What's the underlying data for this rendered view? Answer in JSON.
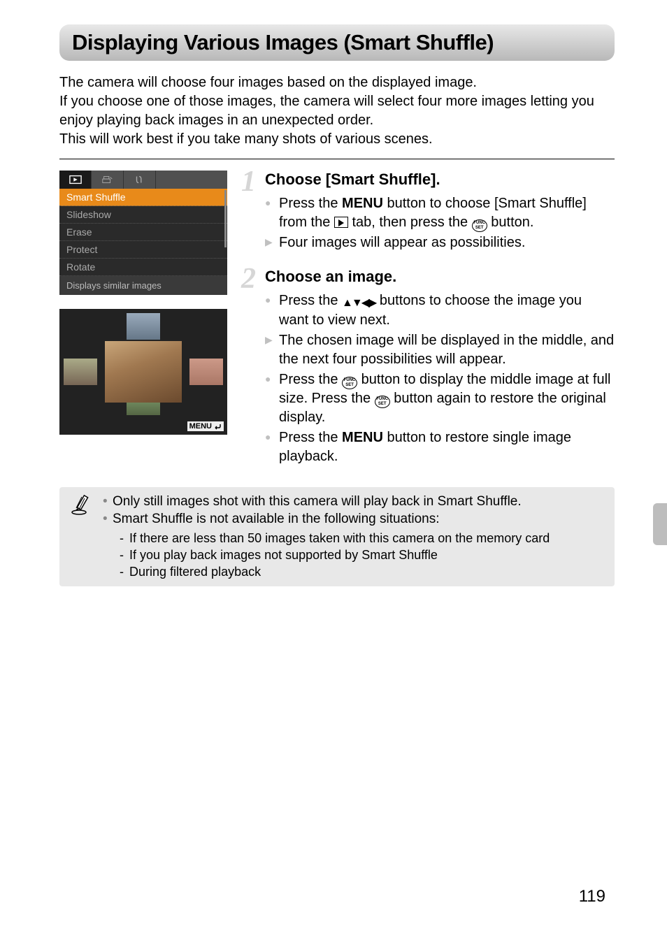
{
  "title": "Displaying Various Images (Smart Shuffle)",
  "intro": "The camera will choose four images based on the displayed image.\nIf you choose one of those images, the camera will select four more images letting you enjoy playing back images in an unexpected order.\nThis will work best if you take many shots of various scenes.",
  "camera_menu": {
    "items": [
      "Smart Shuffle",
      "Slideshow",
      "Erase",
      "Protect",
      "Rotate"
    ],
    "hint": "Displays similar images"
  },
  "preview": {
    "menu_label": "MENU"
  },
  "steps": [
    {
      "num": "1",
      "title": "Choose [Smart Shuffle].",
      "bullets": [
        {
          "kind": "circle",
          "pre": "Press the ",
          "menu": "MENU",
          "mid1": " button to choose [Smart Shuffle] from the ",
          "playtab": true,
          "mid2": " tab, then press the ",
          "func": true,
          "post": " button."
        },
        {
          "kind": "tri",
          "text": "Four images will appear as possibilities."
        }
      ]
    },
    {
      "num": "2",
      "title": "Choose an image.",
      "bullets": [
        {
          "kind": "circle",
          "pre": "Press the ",
          "arrows": true,
          "post": " buttons to choose the image you want to view next."
        },
        {
          "kind": "tri",
          "text": "The chosen image will be displayed in the middle, and the next four possibilities will appear."
        },
        {
          "kind": "circle",
          "pre": "Press the ",
          "func": true,
          "mid1": " button to display the middle image at full size. Press the ",
          "func2": true,
          "post": " button again to restore the original display."
        },
        {
          "kind": "circle",
          "pre": "Press the ",
          "menu": "MENU",
          "post": " button to restore single image playback."
        }
      ]
    }
  ],
  "notes": {
    "items": [
      "Only still images shot with this camera will play back in Smart Shuffle.",
      "Smart Shuffle is not available in the following situations:"
    ],
    "sub": [
      "If there are less than 50 images taken with this camera on the memory card",
      "If you play back images not supported by Smart Shuffle",
      "During filtered playback"
    ]
  },
  "page_number": "119"
}
